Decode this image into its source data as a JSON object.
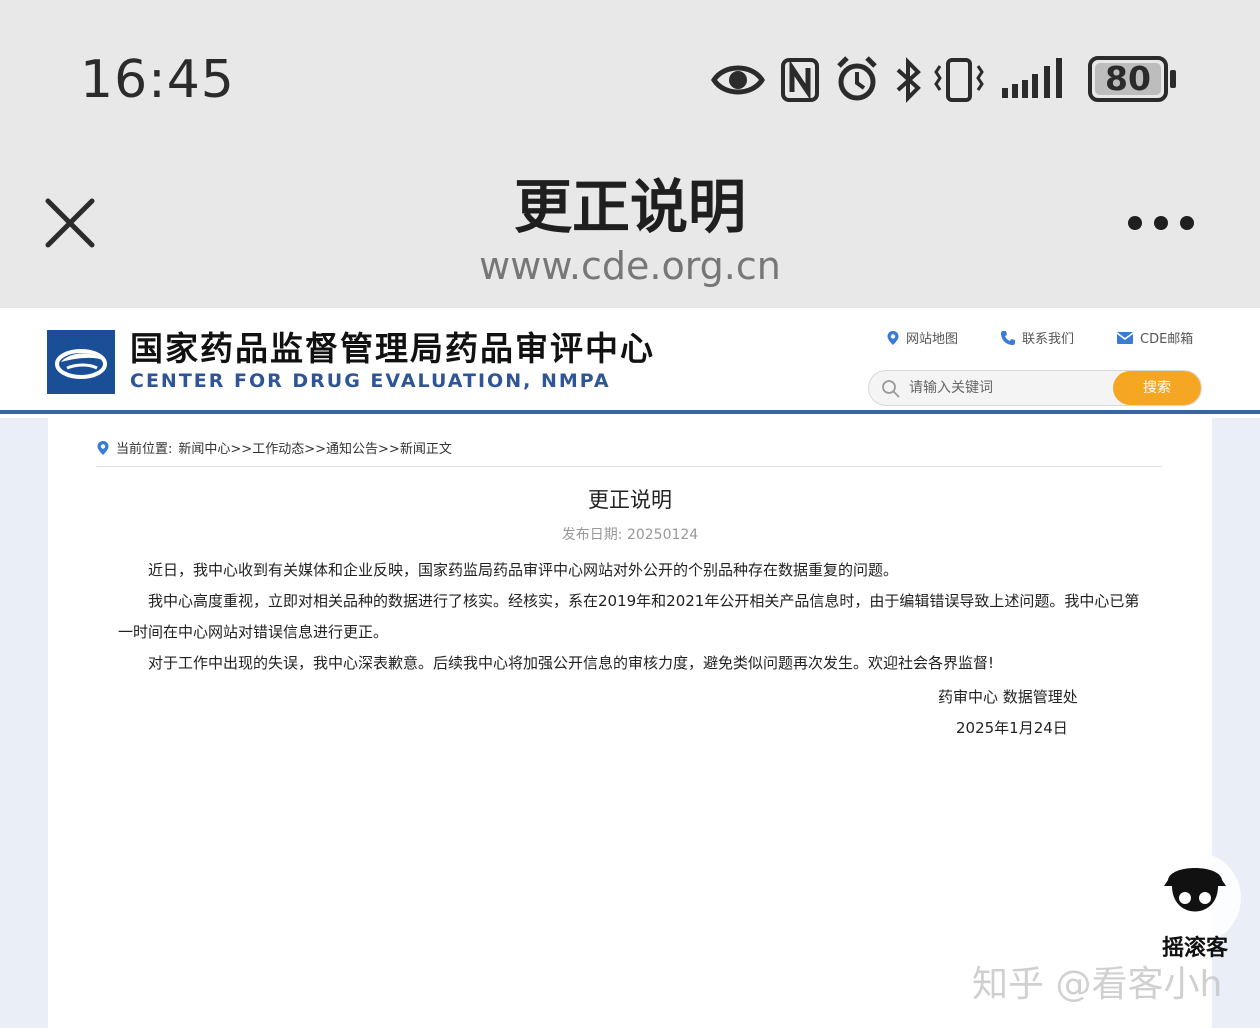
{
  "status_bar": {
    "time": "16:45",
    "battery": "80",
    "icons": [
      "eye-icon",
      "nfc-icon",
      "alarm-icon",
      "bluetooth-icon",
      "vibrate-icon",
      "signal-icon",
      "battery-icon"
    ]
  },
  "browser": {
    "title": "更正说明",
    "url": "www.cde.org.cn"
  },
  "site": {
    "name_cn": "国家药品监督管理局药品审评中心",
    "name_en": "CENTER FOR DRUG EVALUATION, NMPA",
    "links": {
      "sitemap": "网站地图",
      "contact": "联系我们",
      "mail": "CDE邮箱"
    },
    "search": {
      "placeholder": "请输入关键词",
      "button": "搜索"
    },
    "colors": {
      "brand_blue": "#1a4f98",
      "accent_orange": "#f5a623"
    }
  },
  "breadcrumb": {
    "label": "当前位置:",
    "items": [
      "新闻中心",
      "工作动态",
      "通知公告",
      "新闻正文"
    ],
    "sep": ">>"
  },
  "article": {
    "title": "更正说明",
    "date": "发布日期: 20250124",
    "paragraphs": [
      "近日，我中心收到有关媒体和企业反映，国家药监局药品审评中心网站对外公开的个别品种存在数据重复的问题。",
      "我中心高度重视，立即对相关品种的数据进行了核实。经核实，系在2019年和2021年公开相关产品信息时，由于编辑错误导致上述问题。我中心已第一时间在中心网站对错误信息进行更正。",
      "对于工作中出现的失误，我中心深表歉意。后续我中心将加强公开信息的审核力度，避免类似问题再次发生。欢迎社会各界监督!"
    ],
    "signature": "药审中心 数据管理处",
    "sign_date": "2025年1月24日"
  },
  "watermark": {
    "badge": "摇滚客",
    "text": "知乎 @看客小h"
  }
}
